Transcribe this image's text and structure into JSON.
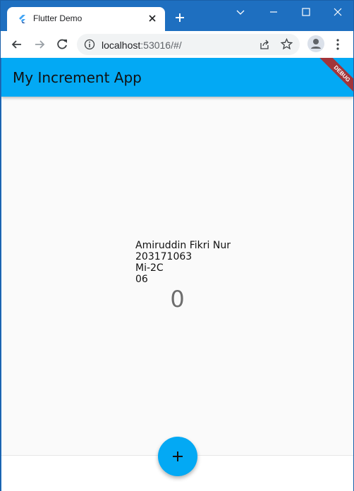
{
  "browser": {
    "tab_title": "Flutter Demo",
    "url_host": "localhost",
    "url_rest": ":53016/#/",
    "icons": [
      "flutter-icon",
      "close-icon",
      "plus-icon",
      "chevron-down-icon",
      "minimize-icon",
      "maximize-icon",
      "window-close-icon",
      "back-icon",
      "forward-icon",
      "reload-icon",
      "info-icon",
      "share-icon",
      "star-icon",
      "profile-icon",
      "kebab-menu-icon"
    ]
  },
  "app": {
    "title": "My Increment App",
    "debug_label": "DEBUG",
    "info_lines": [
      "Amiruddin Fikri Nur",
      "203171063",
      "Mi-2C",
      "06"
    ],
    "counter": "0",
    "accent_color": "#03a9f4"
  }
}
